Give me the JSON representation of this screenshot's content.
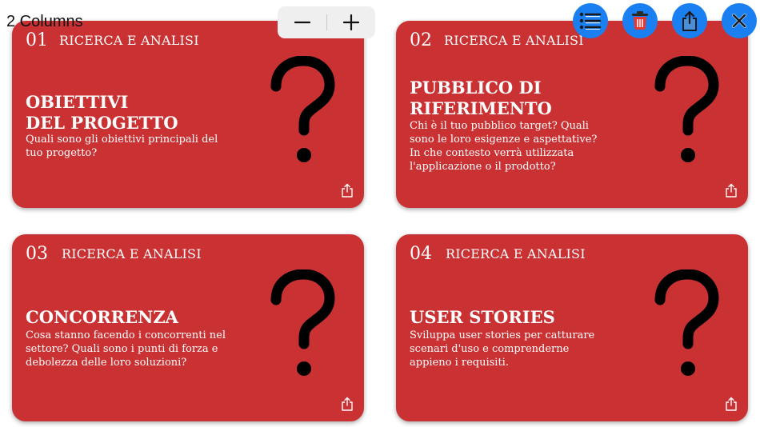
{
  "header": {
    "columns_label": "2 Columns",
    "stepper": {
      "decrement_icon": "minus-icon",
      "increment_icon": "plus-icon"
    },
    "actions": [
      {
        "name": "list-icon"
      },
      {
        "name": "trash-icon"
      },
      {
        "name": "share-icon"
      },
      {
        "name": "close-icon"
      }
    ]
  },
  "colors": {
    "card": "#c93133",
    "accent": "#1a7ff0",
    "stepper_bg": "#efefef"
  },
  "cards": [
    {
      "number": "01",
      "category": "RICERCA E ANALISI",
      "title_line1": "OBIETTIVI",
      "title_line2": "DEL PROGETTO",
      "description": "Quali sono gli obiettivi principali del tuo progetto?"
    },
    {
      "number": "02",
      "category": "RICERCA E ANALISI",
      "title_line1": "PUBBLICO DI",
      "title_line2": "RIFERIMENTO",
      "description": "Chi è il tuo pubblico target? Quali sono le loro esigenze e aspettative? In che contesto verrà utilizzata l'applicazione o il prodotto?"
    },
    {
      "number": "03",
      "category": "RICERCA E ANALISI",
      "title_line1": "CONCORRENZA",
      "title_line2": "",
      "description": "Cosa stanno facendo i concorrenti nel settore? Quali sono i punti di forza e debolezza delle loro soluzioni?"
    },
    {
      "number": "04",
      "category": "RICERCA E ANALISI",
      "title_line1": "USER STORIES",
      "title_line2": "",
      "description": "Sviluppa user stories per catturare scenari d'uso e comprenderne appieno i requisiti."
    }
  ]
}
